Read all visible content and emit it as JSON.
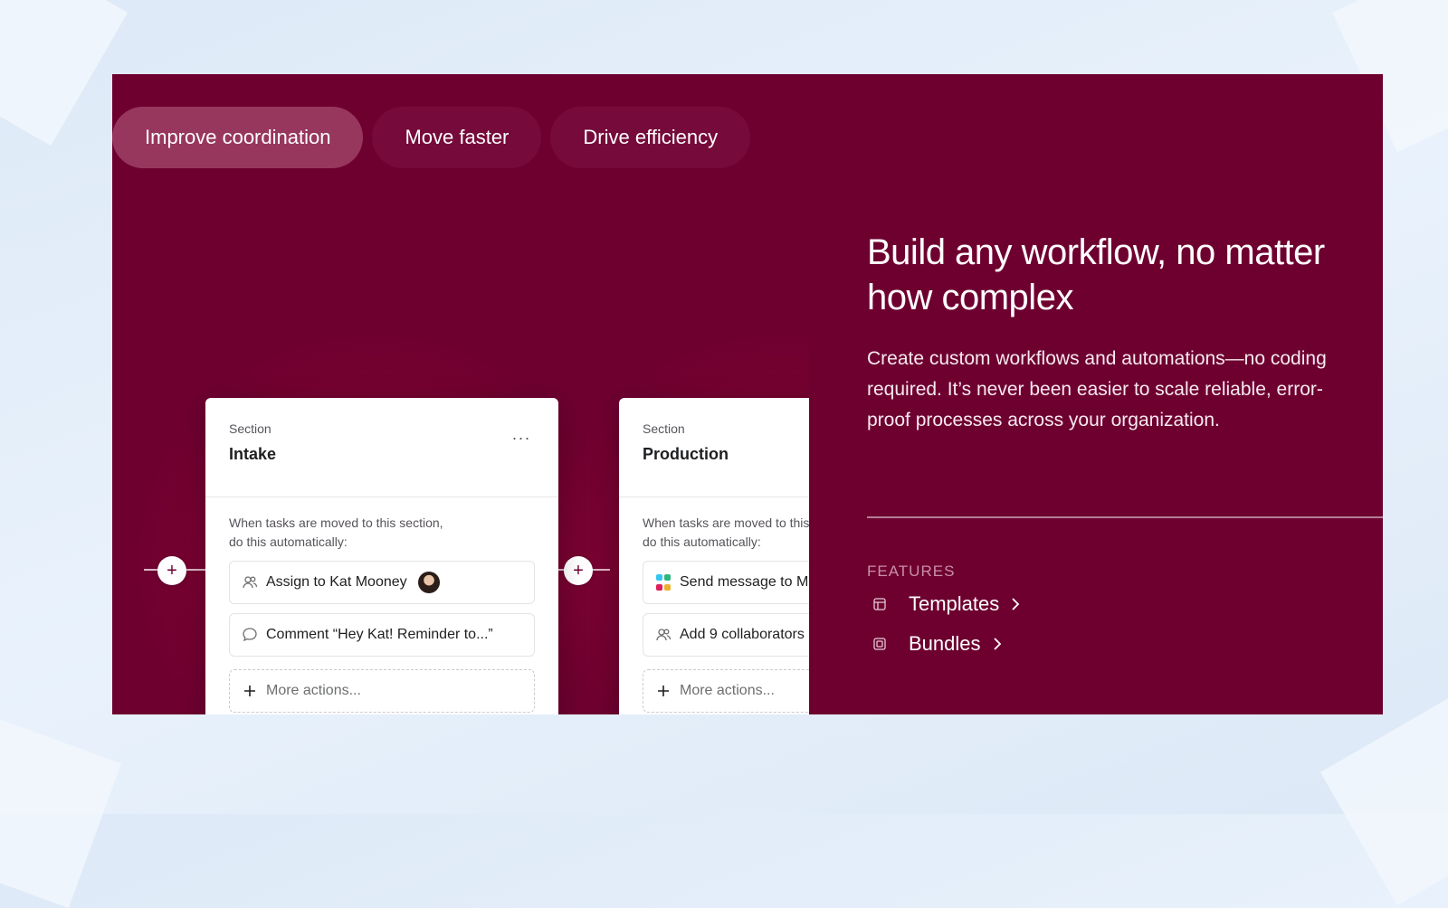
{
  "tabs": [
    {
      "label": "Improve coordination",
      "active": true
    },
    {
      "label": "Move faster",
      "active": false
    },
    {
      "label": "Drive efficiency",
      "active": false
    }
  ],
  "cards": [
    {
      "eyebrow": "Section",
      "title": "Intake",
      "menu": "...",
      "hint": "When tasks are moved to this section,",
      "hint2": "do this automatically:",
      "actions": [
        {
          "icon": "people-icon",
          "label": "Assign to Kat Mooney"
        },
        {
          "icon": "comment-icon",
          "label": "Comment “Hey Kat! Reminder to...”"
        }
      ],
      "more": "More actions..."
    },
    {
      "eyebrow": "Section",
      "title": "Production",
      "hint": "When tasks are moved to this section,",
      "hint2": "do this automatically:",
      "actions": [
        {
          "icon": "slack-icon",
          "label": "Send message to Mark"
        },
        {
          "icon": "people-icon",
          "label": "Add 9 collaborators"
        }
      ],
      "more": "More actions..."
    }
  ],
  "headline": "Build any workflow, no matter how complex",
  "description": "Create custom workflows and automations—no coding required. It’s never been easier to scale reliable, error-proof processes across your organization.",
  "features": {
    "label": "FEATURES",
    "items": [
      {
        "icon": "template-icon",
        "label": "Templates"
      },
      {
        "icon": "bundle-icon",
        "label": "Bundles"
      }
    ]
  },
  "colors": {
    "panel": "#6e0030",
    "active_tab": "#98375d",
    "tab": "#760a3a",
    "slack": [
      "#36c5f0",
      "#2eb67d",
      "#e01e5a",
      "#ecb22e"
    ]
  }
}
